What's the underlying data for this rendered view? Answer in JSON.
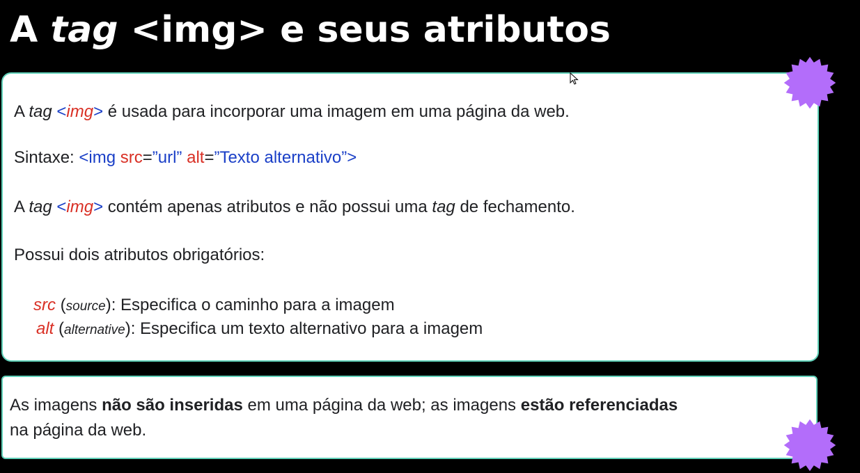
{
  "title": {
    "pre": "A ",
    "italic": "tag",
    "post": " <img> e seus atributos"
  },
  "content": {
    "line1": {
      "pre": "A ",
      "tag_word": "tag",
      "sp": " ",
      "lt": "<",
      "img": "img",
      "gt": ">",
      "post": " é usada para incorporar uma imagem em uma página da web."
    },
    "syntax": {
      "label": "Sintaxe: ",
      "open": "<img ",
      "src_attr": "src",
      "eq1": "=",
      "src_val": "”url”",
      "sp": " ",
      "alt_attr": "alt",
      "eq2": "=",
      "alt_val": "”Texto alternativo”",
      "close": ">"
    },
    "line3": {
      "pre": "A ",
      "tag_word": "tag",
      "sp": " ",
      "lt": "<",
      "img": "img",
      "gt": ">",
      "mid": " contém apenas atributos e não possui uma ",
      "tag_word2": "tag",
      "post": " de fechamento."
    },
    "line4": "Possui dois atributos obrigatórios:",
    "src_item": {
      "name": "src",
      "paren_open": " (",
      "paren_word": "source",
      "paren_close": ")",
      "desc": ": Especifica o caminho para a imagem"
    },
    "alt_item": {
      "name": "alt",
      "paren_open": " (",
      "paren_word": "alternative",
      "paren_close": ")",
      "desc": ": Especifica um texto alternativo para a imagem"
    }
  },
  "note": {
    "p1": "As imagens ",
    "b1": "não são inseridas",
    "p2": " em uma página da web; as imagens ",
    "b2": "estão referenciadas",
    "p3": "na página da web."
  },
  "colors": {
    "background": "#000000",
    "card_border": "#5fd0b8",
    "accent_red": "#d93025",
    "accent_blue": "#1a3fc7",
    "burst": "#b36dfa"
  },
  "icons": [
    "decorative-burst-icon",
    "mouse-cursor-icon"
  ]
}
